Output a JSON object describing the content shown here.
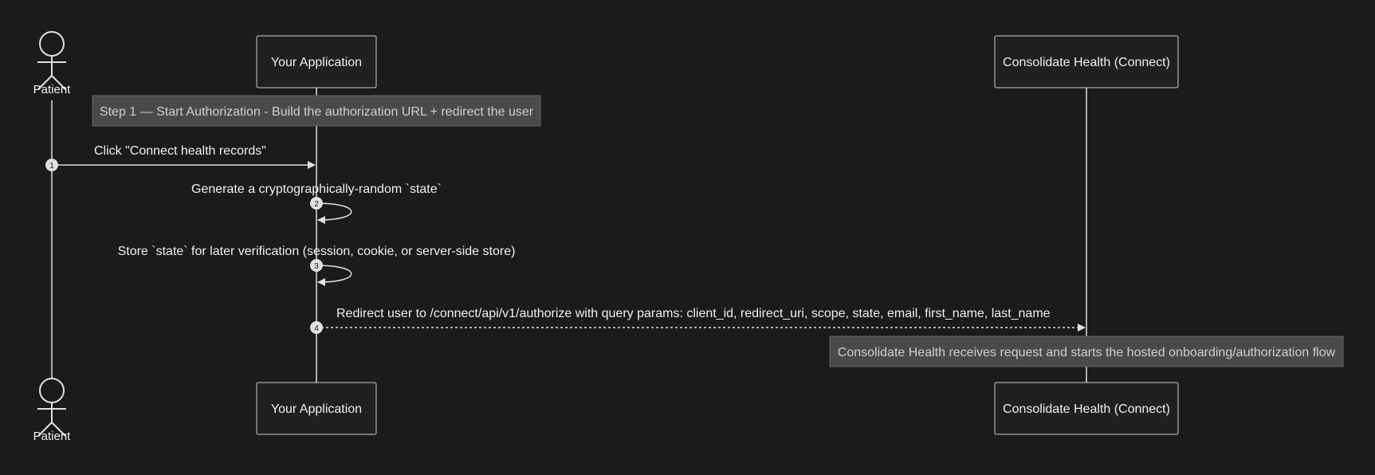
{
  "participants": [
    {
      "id": "patient",
      "label": "Patient",
      "kind": "actor"
    },
    {
      "id": "app",
      "label": "Your Application",
      "kind": "box"
    },
    {
      "id": "ch",
      "label": "Consolidate Health (Connect)",
      "kind": "box"
    }
  ],
  "notes": [
    {
      "text": "Step 1 — Start Authorization - Build the authorization URL + redirect the user"
    },
    {
      "text": "Consolidate Health receives request and starts the hosted onboarding/authorization flow"
    }
  ],
  "messages": [
    {
      "number": "1",
      "from": "patient",
      "to": "app",
      "text": "Click \"Connect health records\"",
      "style": "solid"
    },
    {
      "number": "2",
      "from": "app",
      "to": "app",
      "text": "Generate a cryptographically-random `state`",
      "style": "self"
    },
    {
      "number": "3",
      "from": "app",
      "to": "app",
      "text": "Store `state` for later verification (session, cookie, or server-side store)",
      "style": "self"
    },
    {
      "number": "4",
      "from": "app",
      "to": "ch",
      "text": "Redirect user to /connect/api/v1/authorize with query params: client_id, redirect_uri, scope, state, email, first_name, last_name",
      "style": "dotted"
    }
  ],
  "colors": {
    "background": "#1b1b1b",
    "line": "#e0e0e0",
    "box_fill": "#1f2020",
    "box_stroke": "#cccccc",
    "note_fill": "#4a4a4a",
    "note_stroke": "#666666",
    "note_text": "#d0d0d0",
    "text": "#f0f0f0"
  }
}
